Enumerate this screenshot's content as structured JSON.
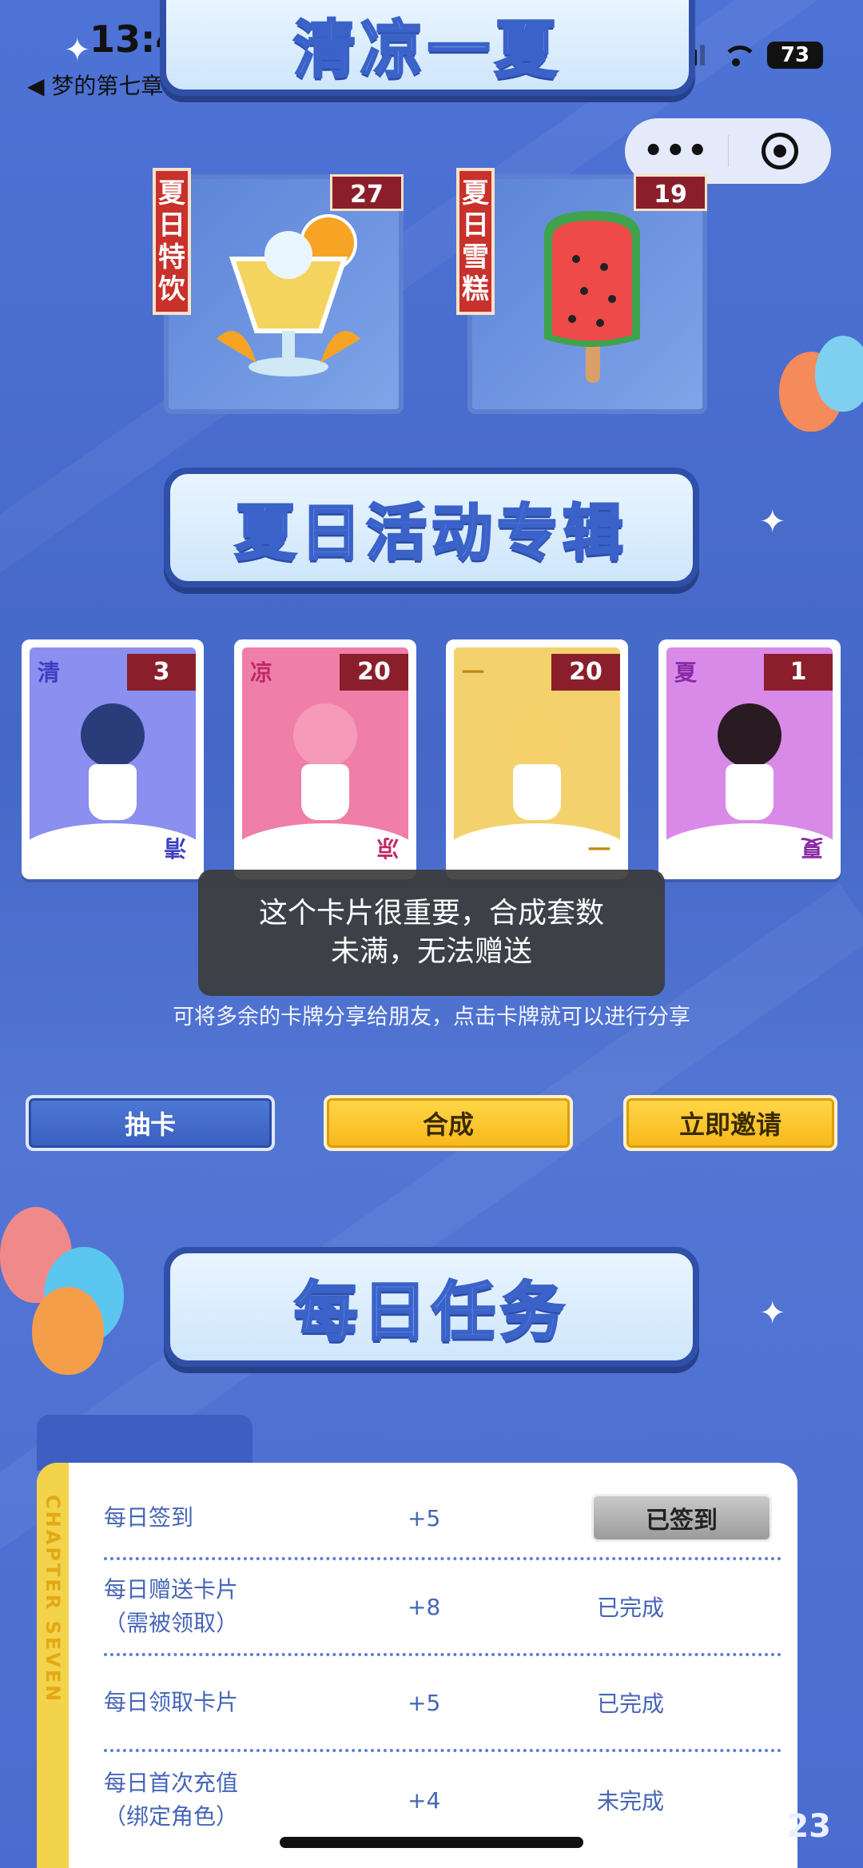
{
  "status_bar": {
    "time": "13:40",
    "back_label": "◀ 梦的第七章",
    "battery": "73"
  },
  "capsule": {
    "more_icon": "•••",
    "close_icon": "target-icon"
  },
  "header": {
    "title": "清凉一夏"
  },
  "products": [
    {
      "tag": "夏日特饮",
      "count": "27",
      "icon": "lemonade-icon"
    },
    {
      "tag": "夏日雪糕",
      "count": "19",
      "icon": "watermelon-popsicle-icon"
    }
  ],
  "album": {
    "title": "夏日活动专辑",
    "cards": [
      {
        "corner": "清",
        "count": "3",
        "color": "#8b8ff0"
      },
      {
        "corner": "凉",
        "count": "20",
        "color": "#ef7fa8"
      },
      {
        "corner": "一",
        "count": "20",
        "color": "#f3d26e"
      },
      {
        "corner": "夏",
        "count": "1",
        "color": "#d98ae8"
      }
    ]
  },
  "toast": {
    "line1": "这个卡片很重要，合成套数",
    "line2": "未满，无法赠送"
  },
  "hint": "可将多余的卡牌分享给朋友，点击卡牌就可以进行分享",
  "buttons": {
    "draw": "抽卡",
    "combine": "合成",
    "invite": "立即邀请"
  },
  "tasks": {
    "title": "每日任务",
    "side_label": "CHAPTER SEVEN",
    "rows": [
      {
        "name": "每日签到",
        "sub": "",
        "points": "+5",
        "status": "已签到"
      },
      {
        "name": "每日赠送卡片",
        "sub": "（需被领取）",
        "points": "+8",
        "status": "已完成"
      },
      {
        "name": "每日领取卡片",
        "sub": "",
        "points": "+5",
        "status": "已完成"
      },
      {
        "name": "每日首次充值",
        "sub": "（绑定角色）",
        "points": "+4",
        "status": "未完成"
      }
    ]
  },
  "page_number": "23"
}
